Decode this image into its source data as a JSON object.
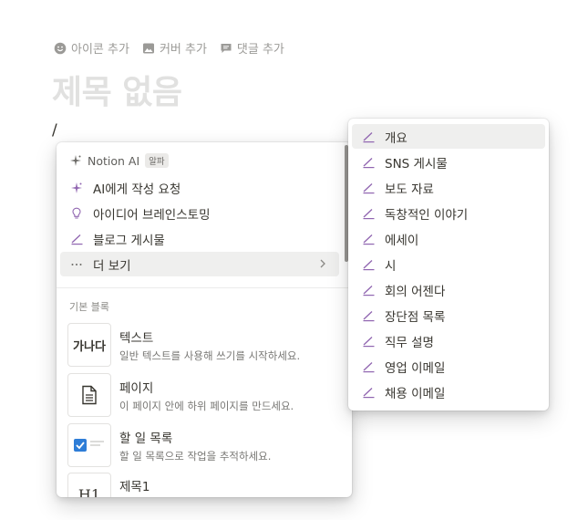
{
  "page_actions": [
    {
      "label": "아이콘 추가",
      "icon": "smiley-icon"
    },
    {
      "label": "커버 추가",
      "icon": "image-icon"
    },
    {
      "label": "댓글 추가",
      "icon": "comment-icon"
    }
  ],
  "page": {
    "title_placeholder": "제목 없음",
    "slash_text": "/"
  },
  "slash_menu": {
    "ai_header": {
      "label": "Notion AI",
      "badge": "알파"
    },
    "items": [
      {
        "label": "AI에게 작성 요청",
        "icon": "sparkle-icon"
      },
      {
        "label": "아이디어 브레인스토밍",
        "icon": "lightbulb-icon"
      },
      {
        "label": "블로그 게시물",
        "icon": "pen-icon"
      },
      {
        "label": "더 보기",
        "icon": "more-icon",
        "active": true
      }
    ],
    "section_label": "기본 블록",
    "blocks": [
      {
        "title": "텍스트",
        "desc": "일반 텍스트를 사용해 쓰기를 시작하세요.",
        "thumb": "가나다"
      },
      {
        "title": "페이지",
        "desc": "이 페이지 안에 하위 페이지를 만드세요.",
        "thumb": "page-icon"
      },
      {
        "title": "할 일 목록",
        "desc": "할 일 목록으로 작업을 추적하세요.",
        "thumb": "checkbox-icon"
      },
      {
        "title": "제목1",
        "desc": "",
        "thumb": "H1"
      }
    ]
  },
  "sub_menu": {
    "items": [
      {
        "label": "개요",
        "active": true
      },
      {
        "label": "SNS 게시물"
      },
      {
        "label": "보도 자료"
      },
      {
        "label": "독창적인 이야기"
      },
      {
        "label": "에세이"
      },
      {
        "label": "시"
      },
      {
        "label": "회의 어젠다"
      },
      {
        "label": "장단점 목록"
      },
      {
        "label": "직무 설명"
      },
      {
        "label": "영업 이메일"
      },
      {
        "label": "채용 이메일"
      }
    ]
  },
  "colors": {
    "ai_accent": "#9065b0",
    "checkbox_blue": "#2e7dd7",
    "hover_bg": "#efefee"
  }
}
